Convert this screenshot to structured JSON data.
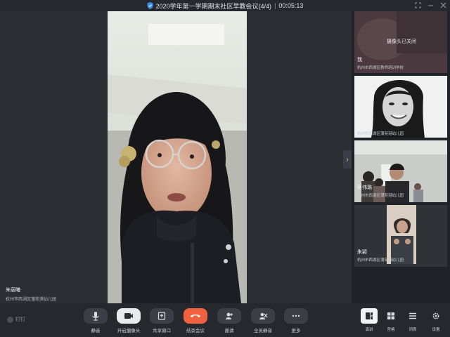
{
  "window": {
    "title": "2020学年第一学期期末社区早教会议(4/4)",
    "timer": "00:05:13"
  },
  "main": {
    "speaker_name": "朱丽曦",
    "speaker_org": "杭州市西湖区蒲苑港幼儿园"
  },
  "participants": [
    {
      "name": "我",
      "org": "杭州市西湖区教师培训学校",
      "camera_status": "摄像头已关闭"
    },
    {
      "name": "",
      "org": "杭州市西湖区蒲苑港幼儿园"
    },
    {
      "name": "蒋伟璐",
      "org": "杭州市西湖区蒲苑港幼儿园"
    },
    {
      "name": "朱颖",
      "org": "杭州市西湖区蒲苑港幼儿园"
    }
  ],
  "toolbar": {
    "brand": "钉钉",
    "mute": "静音",
    "start_camera": "开启摄像头",
    "share_window": "共享窗口",
    "end_meeting": "结束会议",
    "invite": "邀请",
    "mute_all": "全员静音",
    "more": "更多",
    "speaker_view": "演讲",
    "gallery_view": "宫格",
    "list_view": "列表",
    "settings": "设置"
  },
  "colors": {
    "end_meeting": "#f0623f",
    "background": "#1f2226"
  }
}
